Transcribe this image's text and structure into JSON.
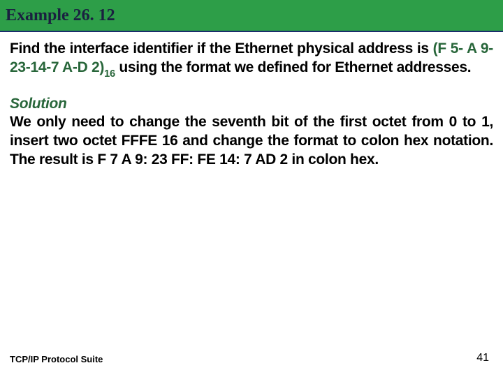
{
  "header": {
    "title": "Example 26. 12"
  },
  "problem": {
    "part1": "Find the interface identifier if the Ethernet physical address is ",
    "hex": "(F 5- A 9-23-14-7 A-D 2)",
    "sub": "16",
    "part2": " using the format we defined for Ethernet addresses."
  },
  "solution": {
    "label": "Solution",
    "body_part1": "We only need to change the seventh bit of the first octet from 0 to 1, insert two octet FFFE 16 and change the format to colon hex notation. The result is ",
    "result": "F 7 A 9: 23 FF: FE 14: 7 AD 2",
    "body_part2": " in colon hex."
  },
  "footer": {
    "left": "TCP/IP Protocol Suite",
    "page": "41"
  }
}
